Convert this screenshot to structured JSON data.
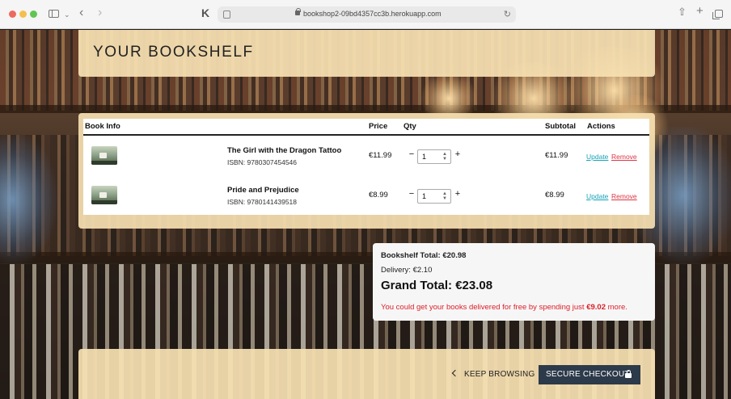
{
  "browser": {
    "url": "bookshop2-09bd4357cc3b.herokuapp.com"
  },
  "header": {
    "title": "YOUR BOOKSHELF"
  },
  "table": {
    "columns": {
      "info": "Book Info",
      "price": "Price",
      "qty": "Qty",
      "subtotal": "Subtotal",
      "actions": "Actions"
    },
    "rows": [
      {
        "title": "The Girl with the Dragon Tattoo",
        "isbn": "ISBN: 9780307454546",
        "price": "€11.99",
        "qty": "1",
        "subtotal": "€11.99",
        "update_label": "Update",
        "remove_label": "Remove"
      },
      {
        "title": "Pride and Prejudice",
        "isbn": "ISBN: 9780141439518",
        "price": "€8.99",
        "qty": "1",
        "subtotal": "€8.99",
        "update_label": "Update",
        "remove_label": "Remove"
      }
    ],
    "minus_symbol": "−",
    "plus_symbol": "+"
  },
  "totals": {
    "bookshelf_total": "Bookshelf Total: €20.98",
    "delivery": "Delivery: €2.10",
    "grand_total": "Grand Total: €23.08",
    "free_delivery_prefix": "You could get your books delivered for free by spending just ",
    "free_delivery_amount": "€9.02",
    "free_delivery_suffix": " more."
  },
  "footer": {
    "keep_browsing_label": "KEEP BROWSING",
    "secure_checkout_label": "SECURE CHECKOUT"
  },
  "colors": {
    "panel": "#f6e0b1",
    "update_link": "#17a2b8",
    "remove_link": "#dc3545",
    "free_delivery_text": "#dc1f26",
    "checkout_button": "#2c3a4a"
  }
}
